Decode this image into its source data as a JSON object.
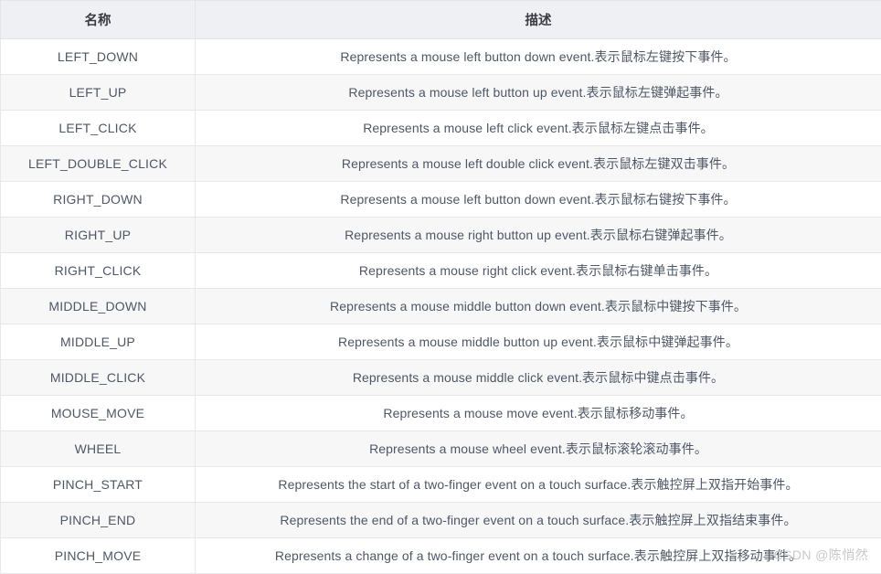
{
  "table": {
    "columns": [
      {
        "key": "name",
        "label": "名称"
      },
      {
        "key": "description",
        "label": "描述"
      }
    ],
    "rows": [
      {
        "name": "LEFT_DOWN",
        "description": "Represents a mouse left button down event.表示鼠标左键按下事件。"
      },
      {
        "name": "LEFT_UP",
        "description": "Represents a mouse left button up event.表示鼠标左键弹起事件。"
      },
      {
        "name": "LEFT_CLICK",
        "description": "Represents a mouse left click event.表示鼠标左键点击事件。"
      },
      {
        "name": "LEFT_DOUBLE_CLICK",
        "description": "Represents a mouse left double click event.表示鼠标左键双击事件。"
      },
      {
        "name": "RIGHT_DOWN",
        "description": "Represents a mouse left button down event.表示鼠标右键按下事件。"
      },
      {
        "name": "RIGHT_UP",
        "description": "Represents a mouse right button up event.表示鼠标右键弹起事件。"
      },
      {
        "name": "RIGHT_CLICK",
        "description": "Represents a mouse right click event.表示鼠标右键单击事件。"
      },
      {
        "name": "MIDDLE_DOWN",
        "description": "Represents a mouse middle button down event.表示鼠标中键按下事件。"
      },
      {
        "name": "MIDDLE_UP",
        "description": "Represents a mouse middle button up event.表示鼠标中键弹起事件。"
      },
      {
        "name": "MIDDLE_CLICK",
        "description": "Represents a mouse middle click event.表示鼠标中键点击事件。"
      },
      {
        "name": "MOUSE_MOVE",
        "description": "Represents a mouse move event.表示鼠标移动事件。"
      },
      {
        "name": "WHEEL",
        "description": "Represents a mouse wheel event.表示鼠标滚轮滚动事件。"
      },
      {
        "name": "PINCH_START",
        "description": "Represents the start of a two-finger event on a touch surface.表示触控屏上双指开始事件。"
      },
      {
        "name": "PINCH_END",
        "description": "Represents the end of a two-finger event on a touch surface.表示触控屏上双指结束事件。"
      },
      {
        "name": "PINCH_MOVE",
        "description": "Represents a change of a two-finger event on a touch surface.表示触控屏上双指移动事件。"
      }
    ]
  },
  "watermark": {
    "text": "CSDN @陈悄然"
  },
  "colors": {
    "header_background": "#eef0f4",
    "header_text": "#3b3b42",
    "row_background_odd": "#ffffff",
    "row_background_even": "#f7f7f8",
    "body_text": "#4e5766",
    "border": "#e8e8ea",
    "watermark_text": "#c8c8cc"
  }
}
